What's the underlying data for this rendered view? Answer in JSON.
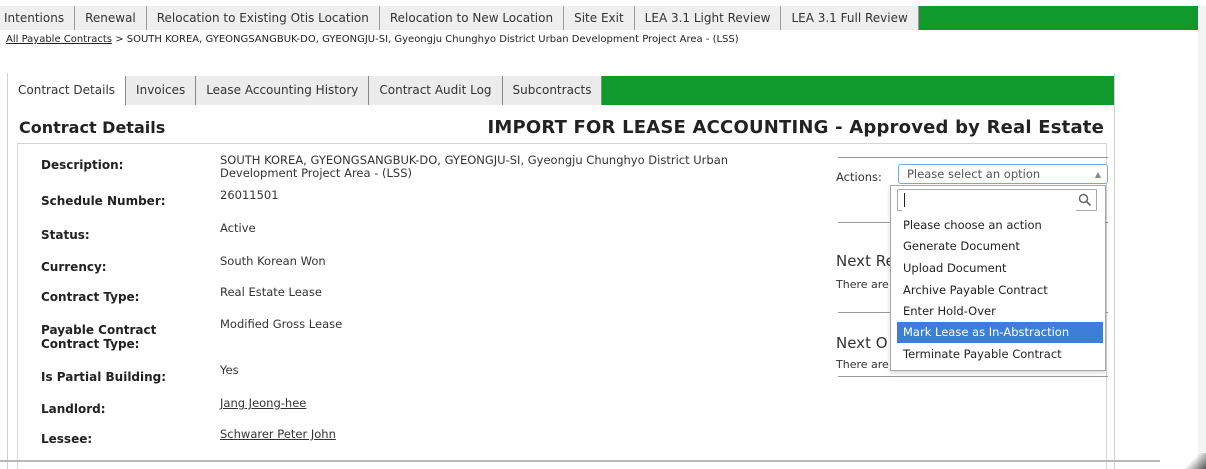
{
  "top_tabs": [
    {
      "label": "Intentions"
    },
    {
      "label": "Renewal"
    },
    {
      "label": "Relocation to Existing Otis Location"
    },
    {
      "label": "Relocation to New Location"
    },
    {
      "label": "Site Exit"
    },
    {
      "label": "LEA 3.1 Light Review"
    },
    {
      "label": "LEA 3.1 Full Review"
    }
  ],
  "breadcrumb": {
    "link": "All Payable Contracts",
    "separator": " > ",
    "current": "SOUTH KOREA, GYEONGSANGBUK-DO, GYEONGJU-SI, Gyeongju Chunghyo District Urban Development Project Area - (LSS)"
  },
  "sub_tabs": [
    {
      "label": "Contract Details",
      "active": true
    },
    {
      "label": "Invoices"
    },
    {
      "label": "Lease Accounting History"
    },
    {
      "label": "Contract Audit Log"
    },
    {
      "label": "Subcontracts"
    }
  ],
  "card_title": "Contract Details",
  "status_title": "IMPORT FOR LEASE ACCOUNTING - Approved by Real Estate",
  "fields": [
    {
      "label": "Description:",
      "value": "SOUTH KOREA, GYEONGSANGBUK-DO, GYEONGJU-SI, Gyeongju Chunghyo District Urban Development Project Area - (LSS)"
    },
    {
      "label": "Schedule Number:",
      "value": "26011501"
    },
    {
      "label": "Status:",
      "value": "Active"
    },
    {
      "label": "Currency:",
      "value": "South Korean Won"
    },
    {
      "label": "Contract Type:",
      "value": "Real Estate Lease"
    },
    {
      "label": "Payable Contract Contract Type:",
      "value": "Modified Gross Lease"
    },
    {
      "label": "Is Partial Building:",
      "value": "Yes"
    },
    {
      "label": "Landlord:",
      "value": "Jang Jeong-hee"
    },
    {
      "label": "Lessee:",
      "value": "Schwarer Peter John"
    }
  ],
  "actions": {
    "label": "Actions:",
    "placeholder": "Please select an option",
    "search_value": "",
    "options": [
      "Please choose an action",
      "Generate Document",
      "Upload Document",
      "Archive Payable Contract",
      "Enter Hold-Over",
      "Mark Lease as In-Abstraction",
      "Terminate Payable Contract"
    ],
    "highlighted": "Mark Lease as In-Abstraction"
  },
  "right_panel": {
    "next_1_heading": "Next Re",
    "next_1_text": "There are",
    "next_2_heading": "Next O",
    "next_2_text": "There are"
  },
  "colors": {
    "tab_bar_green": "#109a2c",
    "highlight_blue": "#3b7fd6"
  }
}
